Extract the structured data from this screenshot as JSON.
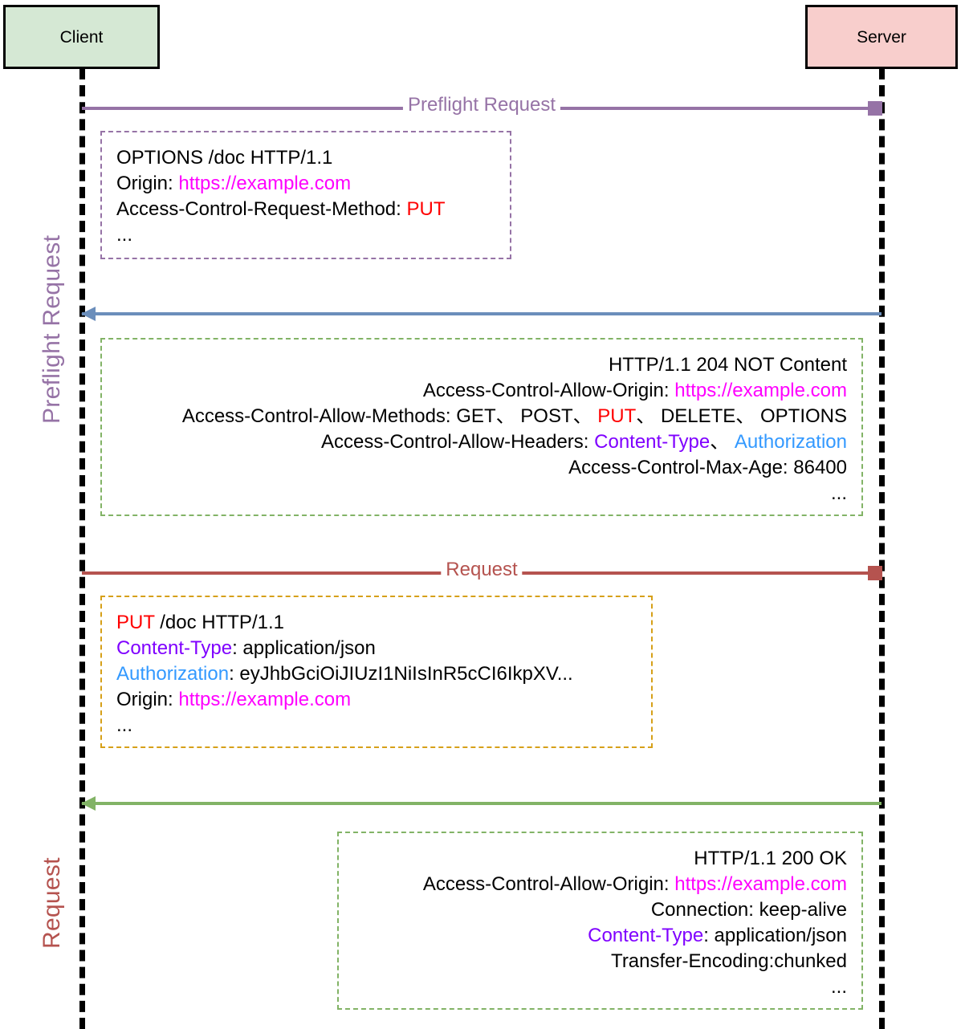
{
  "participants": {
    "client": {
      "label": "Client",
      "fill": "#d5e8d4"
    },
    "server": {
      "label": "Server",
      "fill": "#f8cecc"
    }
  },
  "phases": [
    {
      "id": "preflight",
      "label": "Preflight Request",
      "color": "#9673a6"
    },
    {
      "id": "request",
      "label": "Request",
      "color": "#b5534f"
    }
  ],
  "messages": {
    "preflight_request": {
      "label": "Preflight Request",
      "direction": "to-right",
      "color": "#9673a6"
    },
    "preflight_response": {
      "label": "",
      "direction": "to-left",
      "color": "#6b8ebb"
    },
    "actual_request": {
      "label": "Request",
      "direction": "to-right",
      "color": "#b5534f"
    },
    "actual_response": {
      "label": "",
      "direction": "to-left",
      "color": "#82b366"
    }
  },
  "notes": {
    "preflight_request": {
      "border_color": "#9673a6",
      "align": "left",
      "lines": [
        {
          "parts": [
            {
              "text": "OPTIONS /doc HTTP/1.1",
              "color": "black"
            }
          ]
        },
        {
          "parts": [
            {
              "text": "Origin: ",
              "color": "black"
            },
            {
              "text": "https://example.com",
              "color": "magenta"
            }
          ]
        },
        {
          "parts": [
            {
              "text": "Access-Control-Request-Method: ",
              "color": "black"
            },
            {
              "text": "PUT",
              "color": "red"
            }
          ]
        },
        {
          "parts": [
            {
              "text": "...",
              "color": "black"
            }
          ]
        }
      ]
    },
    "preflight_response": {
      "border_color": "#82b366",
      "align": "right",
      "lines": [
        {
          "parts": [
            {
              "text": "HTTP/1.1 204 NOT Content",
              "color": "black"
            }
          ]
        },
        {
          "parts": [
            {
              "text": "Access-Control-Allow-Origin: ",
              "color": "black"
            },
            {
              "text": "https://example.com",
              "color": "magenta"
            }
          ]
        },
        {
          "parts": [
            {
              "text": "Access-Control-Allow-Methods: GET、 POST、 ",
              "color": "black"
            },
            {
              "text": "PUT",
              "color": "red"
            },
            {
              "text": "、 DELETE、 OPTIONS",
              "color": "black"
            }
          ]
        },
        {
          "parts": [
            {
              "text": "Access-Control-Allow-Headers: ",
              "color": "black"
            },
            {
              "text": "Content-Type",
              "color": "purple"
            },
            {
              "text": "、 ",
              "color": "black"
            },
            {
              "text": "Authorization",
              "color": "blue"
            }
          ]
        },
        {
          "parts": [
            {
              "text": "Access-Control-Max-Age: 86400",
              "color": "black"
            }
          ]
        },
        {
          "parts": [
            {
              "text": "...",
              "color": "black"
            }
          ]
        }
      ]
    },
    "actual_request": {
      "border_color": "#d6a019",
      "align": "left",
      "lines": [
        {
          "parts": [
            {
              "text": "PUT",
              "color": "red"
            },
            {
              "text": " /doc HTTP/1.1",
              "color": "black"
            }
          ]
        },
        {
          "parts": [
            {
              "text": "Content-Type",
              "color": "purple"
            },
            {
              "text": ": application/json",
              "color": "black"
            }
          ]
        },
        {
          "parts": [
            {
              "text": "Authorization",
              "color": "blue"
            },
            {
              "text": ": eyJhbGciOiJIUzI1NiIsInR5cCI6IkpXV...",
              "color": "black"
            }
          ]
        },
        {
          "parts": [
            {
              "text": "Origin: ",
              "color": "black"
            },
            {
              "text": "https://example.com",
              "color": "magenta"
            }
          ]
        },
        {
          "parts": [
            {
              "text": "...",
              "color": "black"
            }
          ]
        }
      ]
    },
    "actual_response": {
      "border_color": "#82b366",
      "align": "right",
      "lines": [
        {
          "parts": [
            {
              "text": "HTTP/1.1 200 OK",
              "color": "black"
            }
          ]
        },
        {
          "parts": [
            {
              "text": "Access-Control-Allow-Origin: ",
              "color": "black"
            },
            {
              "text": "https://example.com",
              "color": "magenta"
            }
          ]
        },
        {
          "parts": [
            {
              "text": "Connection: keep-alive",
              "color": "black"
            }
          ]
        },
        {
          "parts": [
            {
              "text": "Content-Type",
              "color": "purple"
            },
            {
              "text": ": application/json",
              "color": "black"
            }
          ]
        },
        {
          "parts": [
            {
              "text": "Transfer-Encoding:chunked",
              "color": "black"
            }
          ]
        },
        {
          "parts": [
            {
              "text": "...",
              "color": "black"
            }
          ]
        }
      ]
    }
  }
}
